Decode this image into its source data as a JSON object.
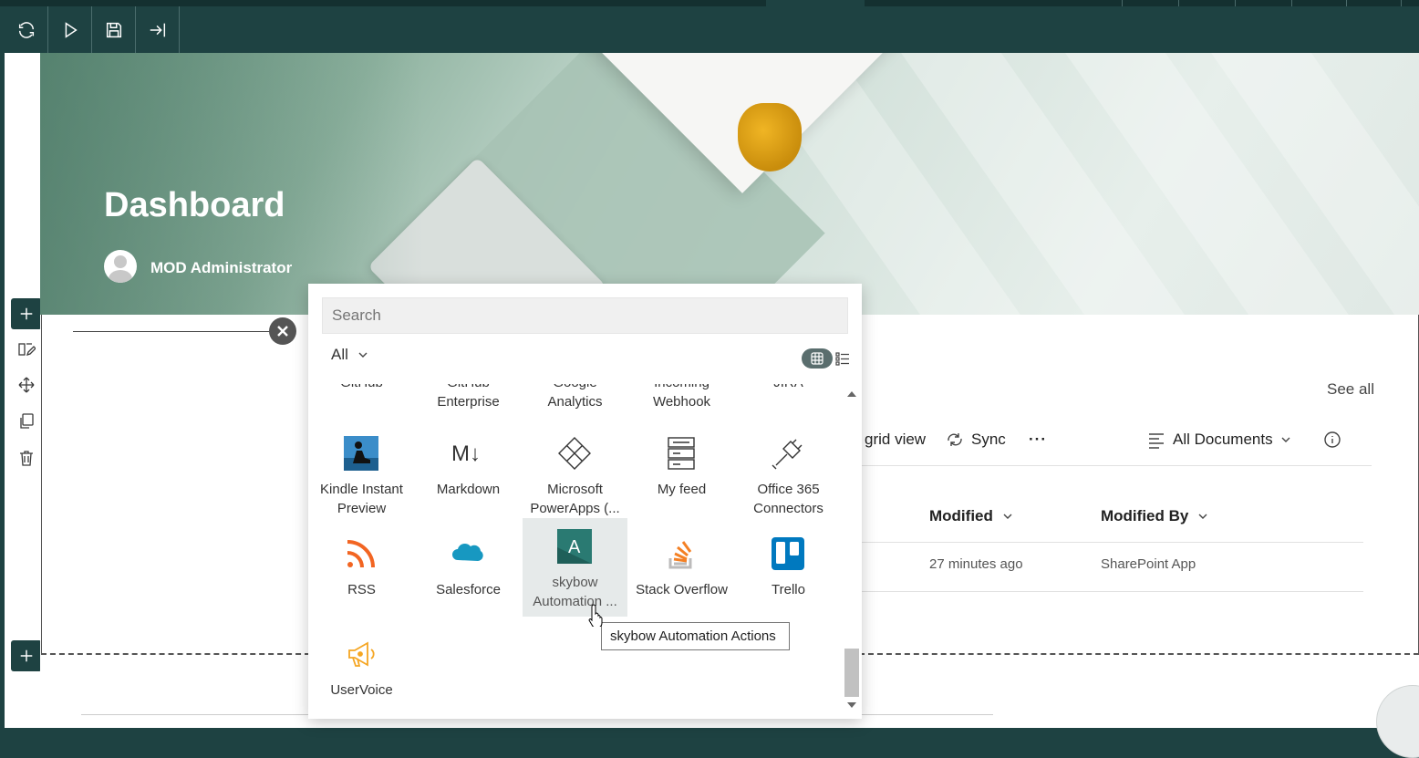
{
  "toolbar": {
    "buttons": [
      {
        "name": "refresh-button",
        "icon": "refresh-icon"
      },
      {
        "name": "play-button",
        "icon": "play-icon"
      },
      {
        "name": "save-button",
        "icon": "save-icon"
      },
      {
        "name": "exit-button",
        "icon": "exit-icon"
      }
    ]
  },
  "hero": {
    "title": "Dashboard",
    "author": "MOD Administrator"
  },
  "webpart": {
    "see_all": "See all",
    "commands": {
      "grid_view": "grid view",
      "sync": "Sync",
      "more": "···",
      "view_name": "All Documents"
    },
    "columns": {
      "modified": "Modified",
      "modified_by": "Modified By"
    },
    "row": {
      "modified": "27 minutes ago",
      "modified_by": "SharePoint App"
    }
  },
  "toolbox": {
    "search_placeholder": "Search",
    "filter": "All",
    "partial_row": [
      "GitHub",
      "GitHub\nEnterprise",
      "Google\nAnalytics",
      "Incoming\nWebhook",
      "JIRA"
    ],
    "tiles": [
      {
        "label": "Kindle Instant Preview",
        "icon": "kindle-icon"
      },
      {
        "label": "Markdown",
        "icon": "markdown-icon"
      },
      {
        "label": "Microsoft PowerApps (...",
        "icon": "powerapps-icon"
      },
      {
        "label": "My feed",
        "icon": "feed-icon"
      },
      {
        "label": "Office 365 Connectors",
        "icon": "plug-icon"
      },
      {
        "label": "RSS",
        "icon": "rss-icon"
      },
      {
        "label": "Salesforce",
        "icon": "salesforce-icon"
      },
      {
        "label": "skybow Automation ...",
        "icon": "skybow-icon"
      },
      {
        "label": "Stack Overflow",
        "icon": "stackoverflow-icon"
      },
      {
        "label": "Trello",
        "icon": "trello-icon"
      },
      {
        "label": "UserVoice",
        "icon": "uservoice-icon"
      }
    ],
    "tooltip": "skybow Automation Actions"
  },
  "colors": {
    "chrome": "#1e4242",
    "rss": "#f26522",
    "salesforce": "#1798c1",
    "skybow": "#2a7a72",
    "stackoverflow": "#f48024",
    "trello": "#0079bf",
    "uservoice": "#f5a623"
  }
}
